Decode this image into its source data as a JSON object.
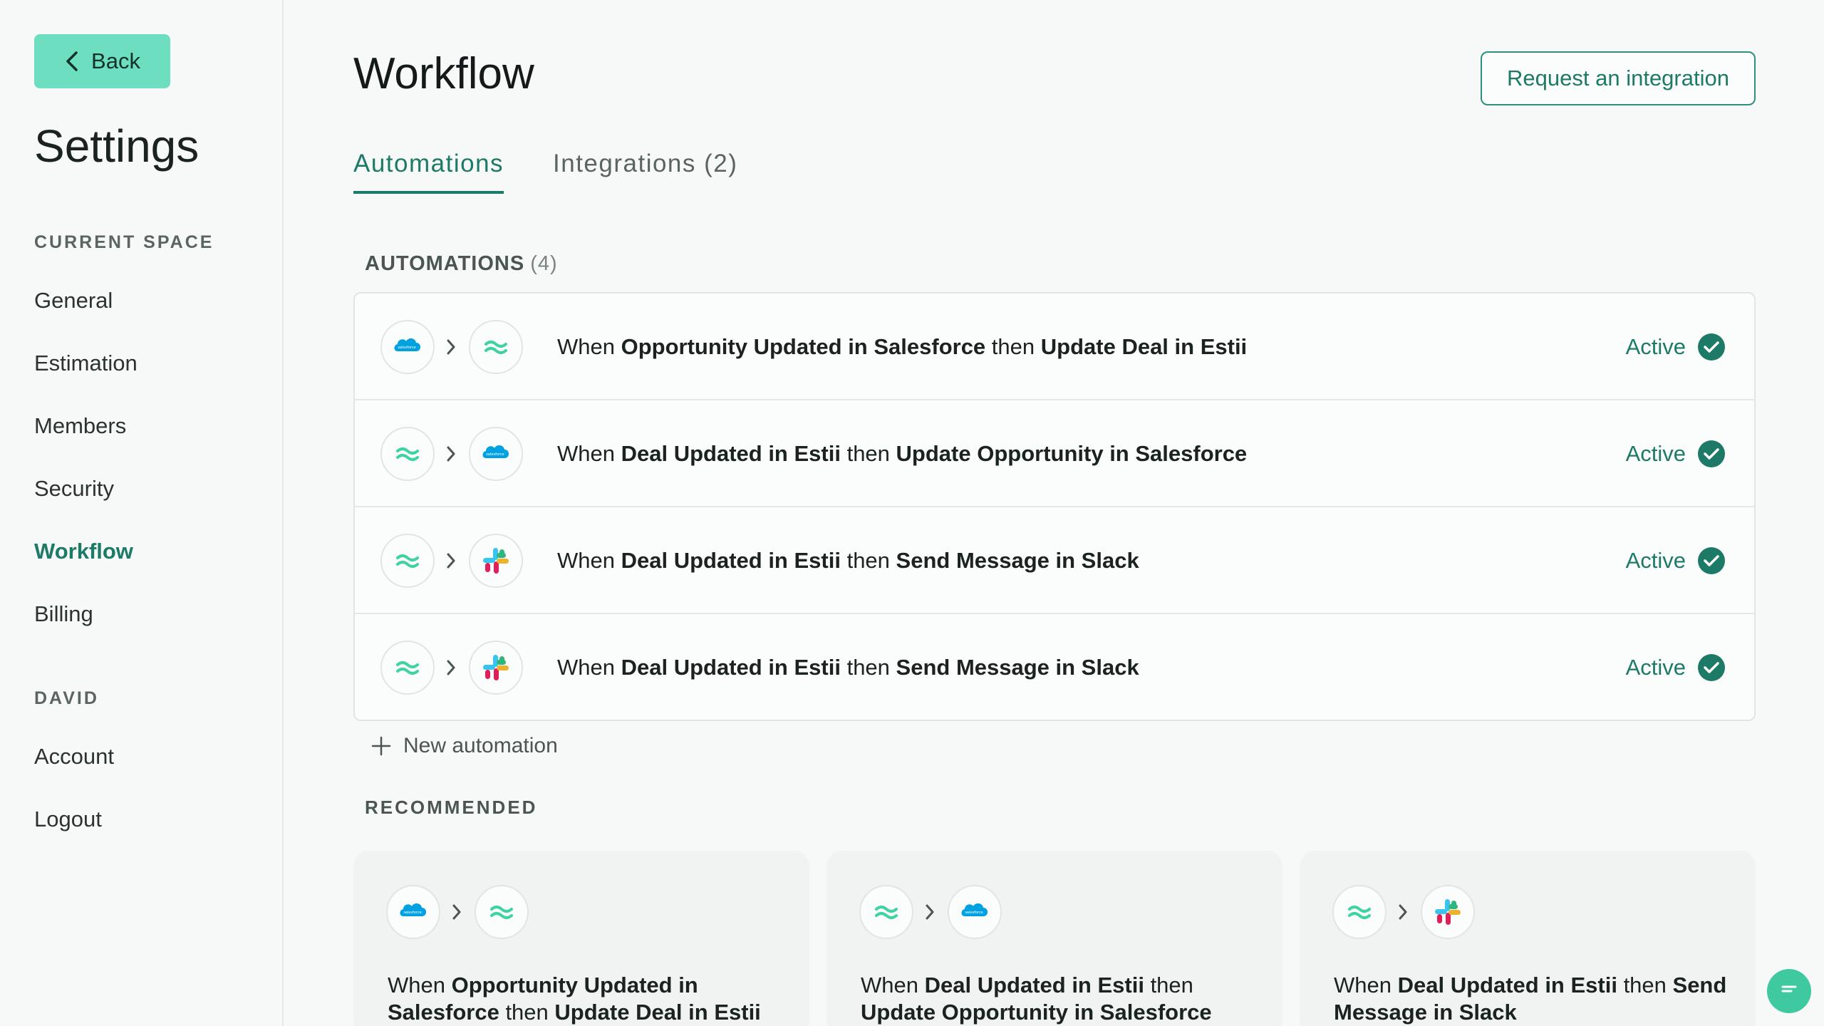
{
  "sidebar": {
    "back_label": "Back",
    "title": "Settings",
    "current_space_label": "CURRENT SPACE",
    "space_items": [
      "General",
      "Estimation",
      "Members",
      "Security",
      "Workflow",
      "Billing"
    ],
    "active_item": "Workflow",
    "user_label": "DAVID",
    "user_items": [
      "Account",
      "Logout"
    ]
  },
  "header": {
    "title": "Workflow",
    "request_label": "Request an integration"
  },
  "tabs": [
    {
      "label": "Automations",
      "active": true
    },
    {
      "label": "Integrations (2)",
      "active": false
    }
  ],
  "automations": {
    "label": "AUTOMATIONS",
    "count": "(4)",
    "rows": [
      {
        "from": "salesforce-icon",
        "to": "estii-icon",
        "when": "When ",
        "trigger": "Opportunity Updated in Salesforce",
        "then": " then ",
        "action": "Update Deal in Estii",
        "status": "Active"
      },
      {
        "from": "estii-icon",
        "to": "salesforce-icon",
        "when": "When ",
        "trigger": "Deal Updated in Estii",
        "then": " then ",
        "action": "Update Opportunity in Salesforce",
        "status": "Active"
      },
      {
        "from": "estii-icon",
        "to": "slack-icon",
        "when": "When ",
        "trigger": "Deal Updated in Estii",
        "then": " then ",
        "action": "Send Message in Slack",
        "status": "Active"
      },
      {
        "from": "estii-icon",
        "to": "slack-icon",
        "when": "When ",
        "trigger": "Deal Updated in Estii",
        "then": " then ",
        "action": "Send Message in Slack",
        "status": "Active"
      }
    ]
  },
  "new_automation_label": "New automation",
  "recommended": {
    "label": "RECOMMENDED",
    "cards": [
      {
        "from": "salesforce-icon",
        "to": "estii-icon",
        "when": "When ",
        "trigger": "Opportunity Updated in Salesforce",
        "then": " then ",
        "action": "Update Deal in Estii"
      },
      {
        "from": "estii-icon",
        "to": "salesforce-icon",
        "when": "When ",
        "trigger": "Deal Updated in Estii",
        "then": " then ",
        "action": "Update Opportunity in Salesforce"
      },
      {
        "from": "estii-icon",
        "to": "slack-icon",
        "when": "When ",
        "trigger": "Deal Updated in Estii",
        "then": " then ",
        "action": "Send Message in Slack"
      }
    ]
  },
  "colors": {
    "accent": "#1d7a66",
    "back_button": "#6ddfc0",
    "estii_waves": "#3fd49f",
    "salesforce": "#00a1e0"
  }
}
